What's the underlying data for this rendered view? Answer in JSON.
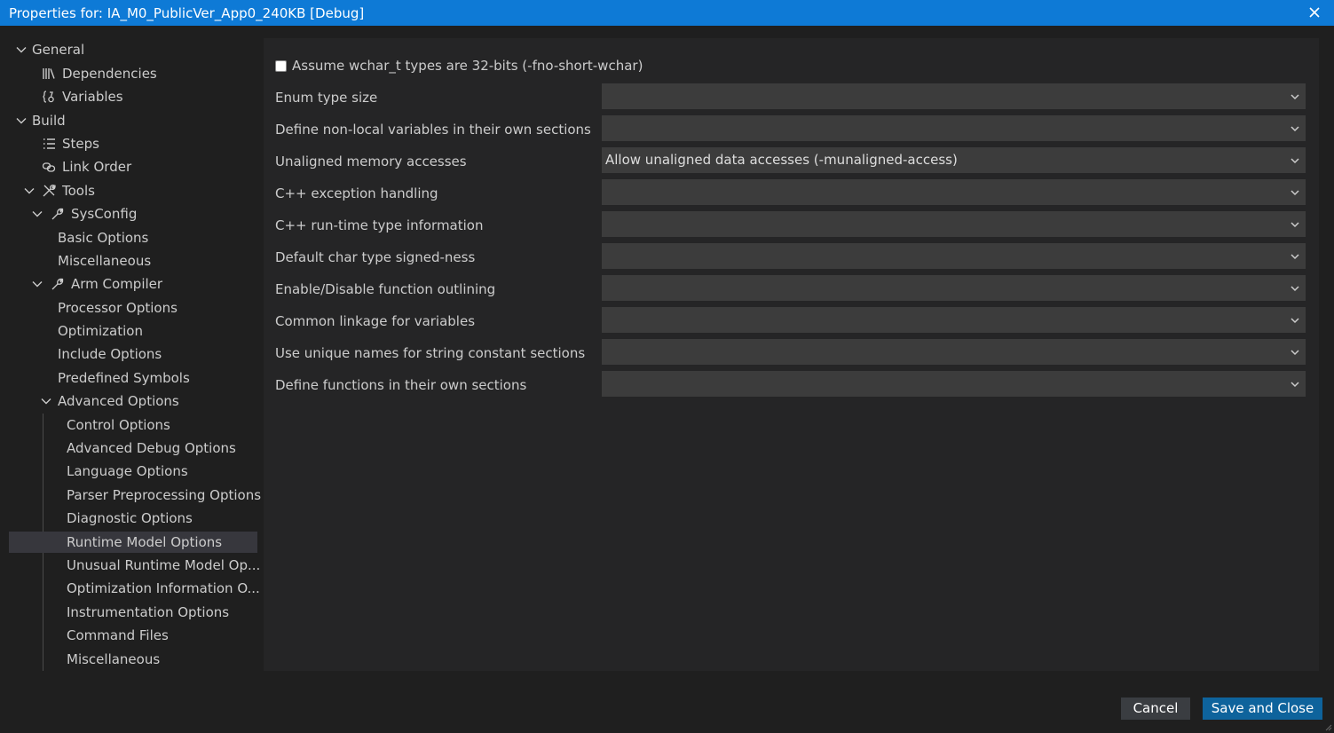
{
  "window": {
    "title": "Properties for: IA_M0_PublicVer_App0_240KB [Debug]"
  },
  "sidebar": {
    "items": [
      {
        "label": "General",
        "icon": "chevron-down-icon"
      },
      {
        "label": "Dependencies",
        "icon": "library-icon"
      },
      {
        "label": "Variables",
        "icon": "variable-braces-icon"
      },
      {
        "label": "Build",
        "icon": "chevron-down-icon"
      },
      {
        "label": "Steps",
        "icon": "list-icon"
      },
      {
        "label": "Link Order",
        "icon": "link-icon"
      },
      {
        "label": "Tools",
        "icon": "tools-icon"
      },
      {
        "label": "SysConfig",
        "icon": "wrench-icon"
      },
      {
        "label": "Basic Options"
      },
      {
        "label": "Miscellaneous"
      },
      {
        "label": "Arm Compiler",
        "icon": "wrench-icon"
      },
      {
        "label": "Processor Options"
      },
      {
        "label": "Optimization"
      },
      {
        "label": "Include Options"
      },
      {
        "label": "Predefined Symbols"
      },
      {
        "label": "Advanced Options",
        "icon": "chevron-down-icon"
      },
      {
        "label": "Control Options"
      },
      {
        "label": "Advanced Debug Options"
      },
      {
        "label": "Language Options"
      },
      {
        "label": "Parser Preprocessing Options"
      },
      {
        "label": "Diagnostic Options"
      },
      {
        "label": "Runtime Model Options",
        "selected": true
      },
      {
        "label": "Unusual Runtime Model Op..."
      },
      {
        "label": "Optimization Information O..."
      },
      {
        "label": "Instrumentation Options"
      },
      {
        "label": "Command Files"
      },
      {
        "label": "Miscellaneous"
      }
    ]
  },
  "main": {
    "checkbox": {
      "label": "Assume wchar_t types are 32-bits (-fno-short-wchar)",
      "checked": false
    },
    "options": [
      {
        "label": "Enum type size",
        "value": ""
      },
      {
        "label": "Define non-local variables in their own sections",
        "value": ""
      },
      {
        "label": "Unaligned memory accesses",
        "value": "Allow unaligned data accesses (-munaligned-access)"
      },
      {
        "label": "C++ exception handling",
        "value": ""
      },
      {
        "label": "C++ run-time type information",
        "value": ""
      },
      {
        "label": "Default char type signed-ness",
        "value": ""
      },
      {
        "label": "Enable/Disable function outlining",
        "value": ""
      },
      {
        "label": "Common linkage for variables",
        "value": ""
      },
      {
        "label": "Use unique names for string constant sections",
        "value": ""
      },
      {
        "label": "Define functions in their own sections",
        "value": ""
      }
    ]
  },
  "footer": {
    "cancel_label": "Cancel",
    "save_label": "Save and Close"
  },
  "colors": {
    "titlebar": "#0e7ad6",
    "background": "#1f1f1f",
    "panel": "#252526",
    "select": "#3c3c3c",
    "selected_row": "#37373d",
    "primary_button": "#0e639c",
    "secondary_button": "#3a3d41"
  }
}
